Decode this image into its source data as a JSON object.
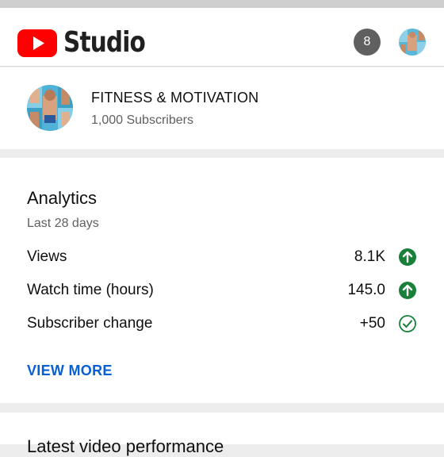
{
  "header": {
    "logo_text": "Studio",
    "notification_count": "8",
    "brand_color": "#ff0000"
  },
  "channel": {
    "name": "FITNESS & MOTIVATION",
    "subscribers": "1,000 Subscribers"
  },
  "analytics": {
    "title": "Analytics",
    "period": "Last 28 days",
    "metrics": [
      {
        "label": "Views",
        "value": "8.1K",
        "icon": "arrow-up-circle-icon"
      },
      {
        "label": "Watch time (hours)",
        "value": "145.0",
        "icon": "arrow-up-circle-icon"
      },
      {
        "label": "Subscriber change",
        "value": "+50",
        "icon": "check-circle-icon"
      }
    ],
    "view_more": "VIEW MORE"
  },
  "next_card": {
    "title": "Latest video performance"
  }
}
